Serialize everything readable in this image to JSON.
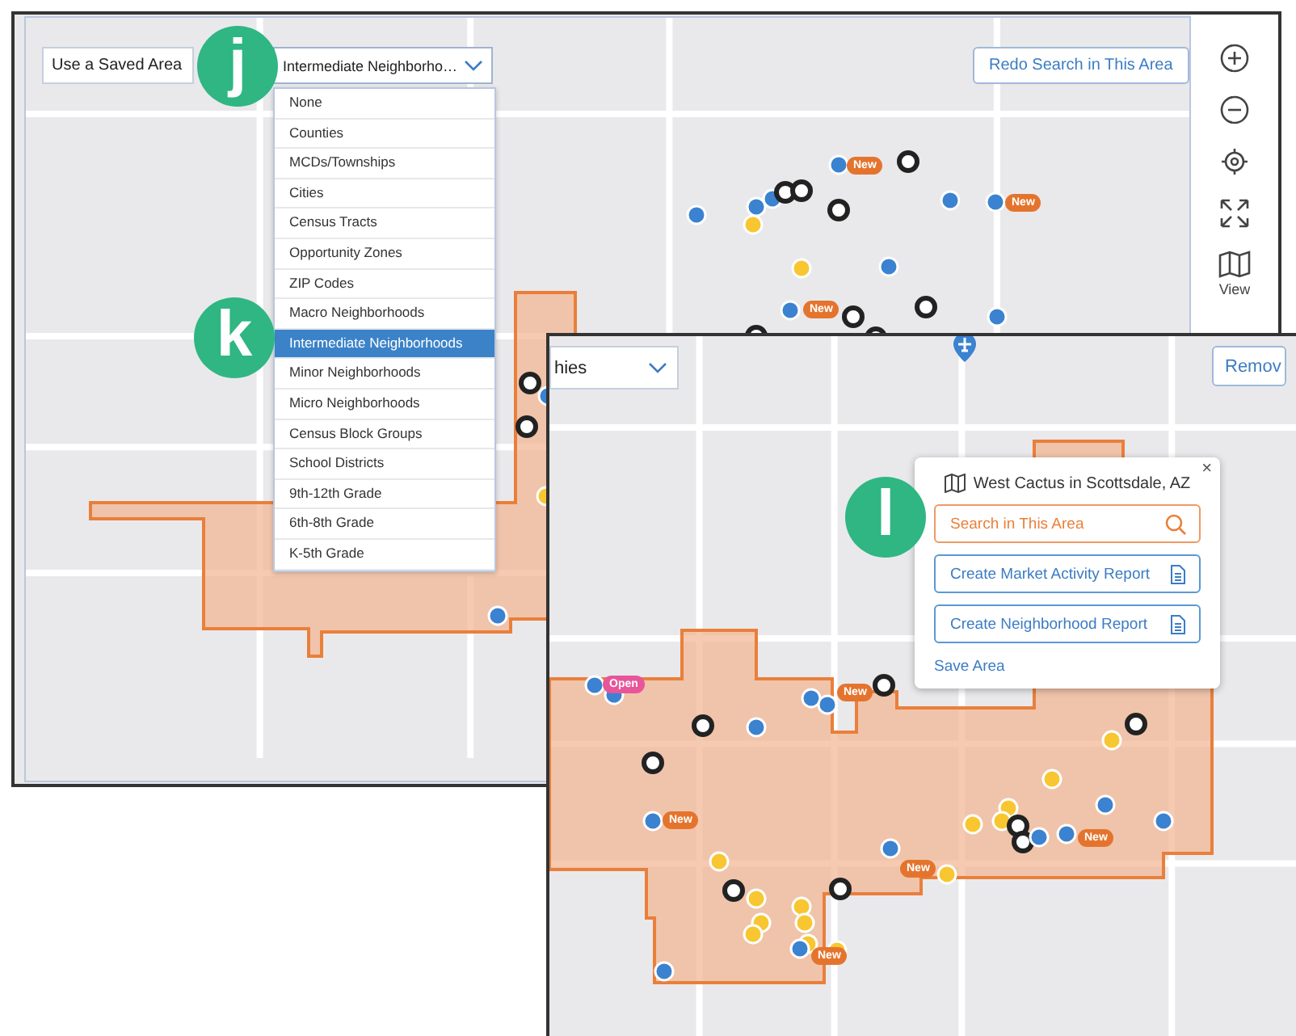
{
  "screen_1": {
    "saved_area_field": {
      "value": "Use a Saved Area"
    },
    "boundary_select": {
      "value": "Intermediate Neighborho…",
      "expanded": true,
      "options": [
        {
          "label": "None",
          "selected": false
        },
        {
          "label": "Counties",
          "selected": false
        },
        {
          "label": "MCDs/Townships",
          "selected": false
        },
        {
          "label": "Cities",
          "selected": false
        },
        {
          "label": "Census Tracts",
          "selected": false
        },
        {
          "label": "Opportunity Zones",
          "selected": false
        },
        {
          "label": "ZIP Codes",
          "selected": false
        },
        {
          "label": "Macro Neighborhoods",
          "selected": false
        },
        {
          "label": "Intermediate Neighborhoods",
          "selected": true
        },
        {
          "label": "Minor Neighborhoods",
          "selected": false
        },
        {
          "label": "Micro Neighborhoods",
          "selected": false
        },
        {
          "label": "Census Block Groups",
          "selected": false
        },
        {
          "label": "School Districts",
          "selected": false
        },
        {
          "label": "9th-12th Grade",
          "selected": false
        },
        {
          "label": "6th-8th Grade",
          "selected": false
        },
        {
          "label": "K-5th Grade",
          "selected": false
        }
      ]
    },
    "redo_button": "Redo Search in This Area",
    "map_controls": {
      "view_label": "View"
    },
    "map_badges": [
      {
        "label": "New",
        "kind": "new"
      },
      {
        "label": "New",
        "kind": "new"
      },
      {
        "label": "New",
        "kind": "new"
      }
    ]
  },
  "screen_2": {
    "boundary_select": {
      "value": "hies"
    },
    "remove_button": "Remov",
    "popup": {
      "close": "×",
      "title": "West Cactus in Scottsdale, AZ",
      "search_button": "Search in This Area",
      "buttons": [
        "Create Market Activity Report",
        "Create Neighborhood Report"
      ],
      "save_link": "Save Area"
    },
    "map_badges": [
      {
        "label": "Open",
        "kind": "open"
      },
      {
        "label": "New",
        "kind": "new"
      },
      {
        "label": "New",
        "kind": "new"
      },
      {
        "label": "New",
        "kind": "new"
      },
      {
        "label": "New",
        "kind": "new"
      },
      {
        "label": "New",
        "kind": "new"
      }
    ]
  },
  "callouts": [
    {
      "label": "j"
    },
    {
      "label": "k"
    },
    {
      "label": "l"
    }
  ]
}
